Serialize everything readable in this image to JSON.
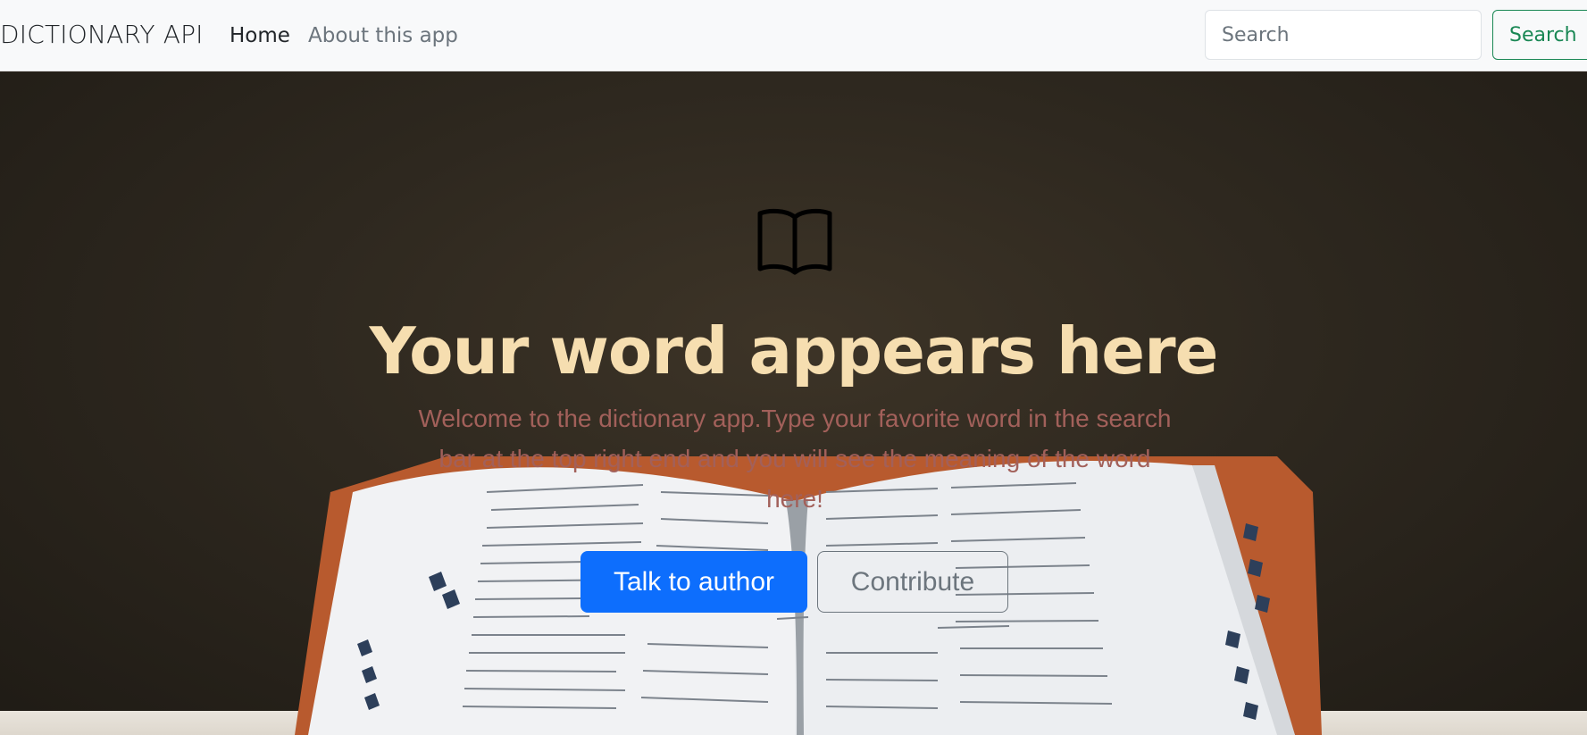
{
  "navbar": {
    "brand": "DICTIONARY API",
    "links": [
      {
        "label": "Home"
      },
      {
        "label": "About this app"
      }
    ],
    "search": {
      "placeholder": "Search",
      "button_label": "Search"
    }
  },
  "hero": {
    "icon": "open-book-icon",
    "title": "Your word appears here",
    "text": "Welcome to the dictionary app.Type your favorite word in the search bar at the top right end and you will see the meaning of the word here!",
    "primary_button": "Talk to author",
    "secondary_button": "Contribute"
  },
  "colors": {
    "navbar_bg": "#f8f9fa",
    "title": "#f6deb0",
    "text": "#a2605a",
    "primary": "#0d6efd",
    "success": "#198754",
    "secondary": "#6c757d"
  }
}
